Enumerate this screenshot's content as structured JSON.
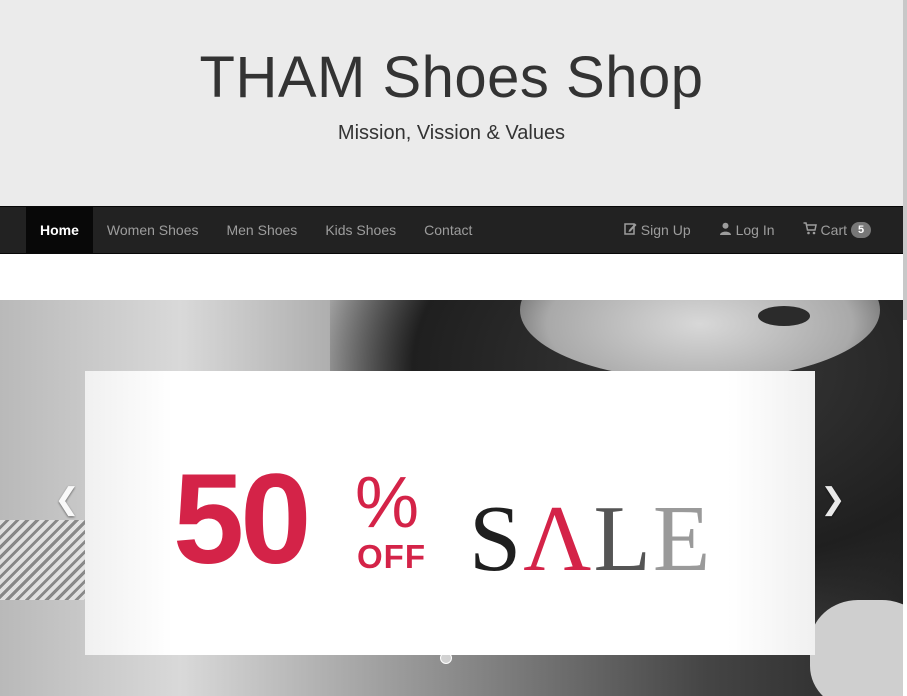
{
  "site": {
    "title": "THAM Shoes Shop",
    "tagline": "Mission, Vission & Values"
  },
  "nav": {
    "left": [
      {
        "label": "Home",
        "active": true
      },
      {
        "label": "Women Shoes",
        "active": false
      },
      {
        "label": "Men Shoes",
        "active": false
      },
      {
        "label": "Kids Shoes",
        "active": false
      },
      {
        "label": "Contact",
        "active": false
      }
    ],
    "right": [
      {
        "label": "Sign Up",
        "icon": "edit-icon"
      },
      {
        "label": "Log In",
        "icon": "user-icon"
      },
      {
        "label": "Cart",
        "icon": "cart-icon",
        "badge": "5"
      }
    ]
  },
  "carousel": {
    "banner": {
      "percent_number": "50",
      "percent_symbol": "%",
      "off_text": "OFF",
      "sale_text": "SALE",
      "sale_letters": [
        "S",
        "Λ",
        "L",
        "E"
      ]
    },
    "prev_icon": "chevron-left-icon",
    "next_icon": "chevron-right-icon"
  },
  "colors": {
    "navbar_bg": "#222222",
    "nav_active_bg": "#080808",
    "nav_text": "#9d9d9d",
    "jumbotron_bg": "#ebebeb",
    "sale_red": "#d42348"
  }
}
